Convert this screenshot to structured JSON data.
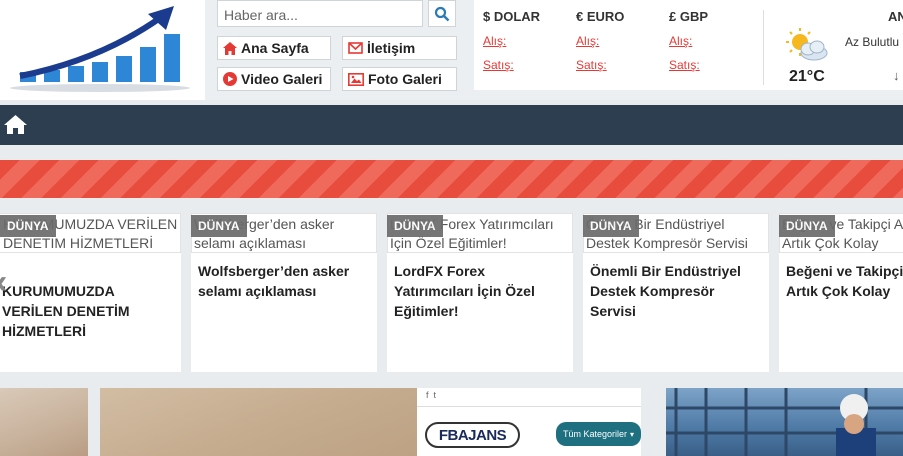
{
  "header": {
    "search": {
      "placeholder": "Haber ara..."
    },
    "nav": {
      "home": "Ana Sayfa",
      "contact": "İletişim",
      "video": "Video Galeri",
      "photo": "Foto Galeri"
    },
    "currency": [
      {
        "title": "$ DOLAR",
        "buy": "Alış:",
        "sell": "Satış:"
      },
      {
        "title": "€ EURO",
        "buy": "Alış:",
        "sell": "Satış:"
      },
      {
        "title": "£ GBP",
        "buy": "Alış:",
        "sell": "Satış:"
      }
    ],
    "weather": {
      "city": "AN",
      "condition": "Az Bulutlu",
      "temp": "21°C",
      "extra": "↓"
    }
  },
  "colors": {
    "navbar": "#2c3e50",
    "accent": "#e74c3c",
    "link": "#e53935"
  },
  "icons": [
    "home-icon",
    "search-icon",
    "envelope-icon",
    "play-icon",
    "image-icon",
    "weather-icon"
  ],
  "cards": [
    {
      "category": "DÜNYA",
      "alt": "KURUMUMUZDA VERİLEN DENETİM HİZMETLERİ",
      "title": "KURUMUMUZDA VERİLEN DENETİM HİZMETLERİ"
    },
    {
      "category": "DÜNYA",
      "alt": "Wolfsberger’den asker selamı açıklaması",
      "title": "Wolfsberger’den asker selamı açıklaması"
    },
    {
      "category": "DÜNYA",
      "alt": "LordFX Forex Yatırımcıları İçin Özel Eğitimler!",
      "title": "LordFX Forex Yatırımcıları İçin Özel Eğitimler!"
    },
    {
      "category": "DÜNYA",
      "alt": "Önemli Bir Endüstriyel Destek Kompresör Servisi",
      "title": "Önemli Bir Endüstriyel Destek Kompresör Servisi"
    },
    {
      "category": "DÜNYA",
      "alt": "Beğeni ve Takipçi Arttırmak Artık Çok Kolay",
      "title": "Beğeni ve Takipçi Arttırmak Artık Çok Kolay"
    }
  ],
  "ad": {
    "brand": "FBAJANS",
    "dropdown": "Tüm Kategoriler"
  }
}
